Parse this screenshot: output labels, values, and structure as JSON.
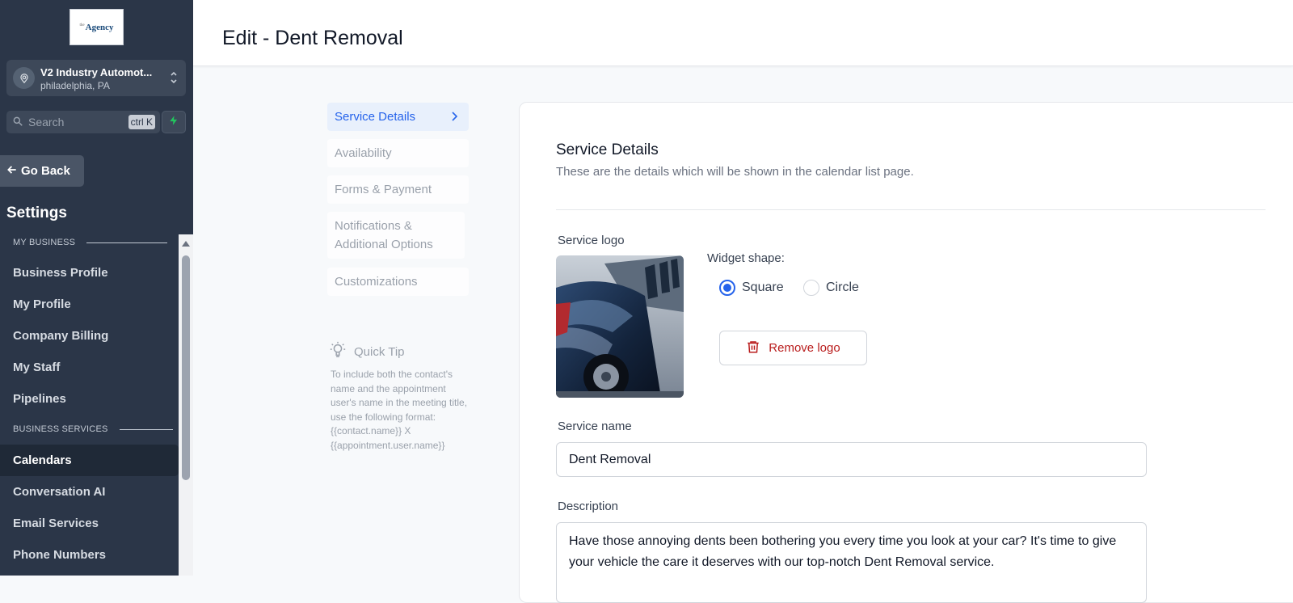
{
  "sidebar": {
    "brand_logo_text": "Agency",
    "brand_logo_sup": "the",
    "location": {
      "name": "V2 Industry Automot...",
      "city": "philadelphia, PA"
    },
    "search": {
      "label": "Search",
      "shortcut": "ctrl K"
    },
    "go_back": "Go Back",
    "settings_title": "Settings",
    "sections": [
      {
        "label": "MY BUSINESS"
      },
      {
        "label": "BUSINESS SERVICES"
      }
    ],
    "items": [
      {
        "label": "Business Profile"
      },
      {
        "label": "My Profile"
      },
      {
        "label": "Company Billing"
      },
      {
        "label": "My Staff"
      },
      {
        "label": "Pipelines"
      },
      {
        "label": "Calendars"
      },
      {
        "label": "Conversation AI"
      },
      {
        "label": "Email Services"
      },
      {
        "label": "Phone Numbers"
      }
    ]
  },
  "header": {
    "title": "Edit - Dent Removal"
  },
  "steps": [
    {
      "label": "Service Details"
    },
    {
      "label": "Availability"
    },
    {
      "label": "Forms & Payment"
    },
    {
      "label": "Notifications & Additional Options"
    },
    {
      "label": "Customizations"
    }
  ],
  "quick_tip": {
    "title": "Quick Tip",
    "body": "To include both the contact's name and the appointment user's name in the meeting title, use the following format: {{contact.name}} X {{appointment.user.name}}"
  },
  "form": {
    "section_title": "Service Details",
    "section_subtitle": "These are the details which will be shown in the calendar list page.",
    "logo_label": "Service logo",
    "widget_shape_label": "Widget shape:",
    "shape_options": [
      "Square",
      "Circle"
    ],
    "shape_selected": "Square",
    "remove_logo": "Remove logo",
    "name_label": "Service name",
    "name_value": "Dent Removal",
    "description_label": "Description",
    "description_value": "Have those annoying dents been bothering you every time you look at your car? It's time to give your vehicle the care it deserves with our top-notch Dent Removal service."
  },
  "colors": {
    "sidebar_bg": "#2b3648",
    "accent": "#2563eb",
    "danger": "#b91c1c",
    "bolt": "#22c55e"
  }
}
